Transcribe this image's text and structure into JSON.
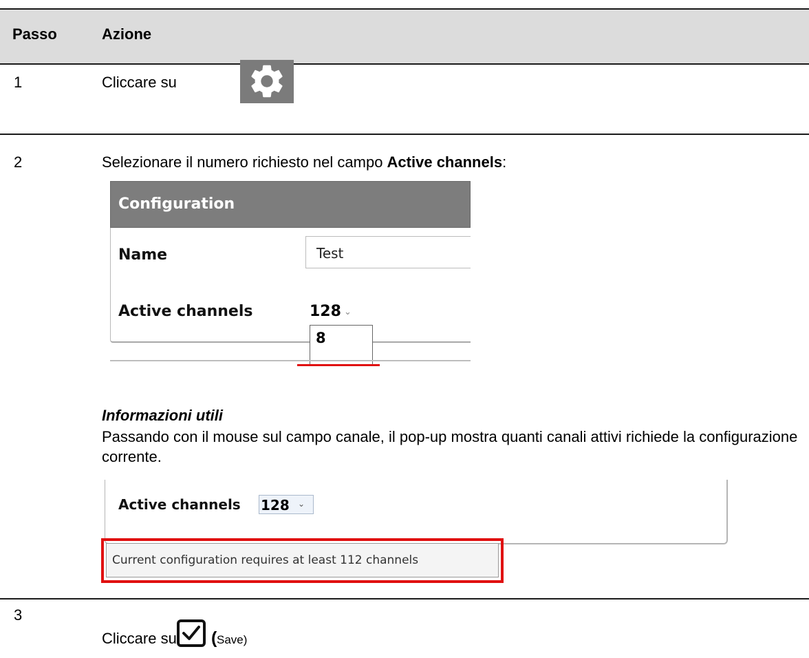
{
  "header": {
    "col1": "Passo",
    "col2": "Azione"
  },
  "steps": [
    {
      "num": "1",
      "text": "Cliccare su",
      "icon": "gear-icon"
    },
    {
      "num": "2",
      "text_pre": "Selezionare il numero richiesto nel campo ",
      "text_bold": "Active channels",
      "text_post": ":",
      "config": {
        "title": "Configuration",
        "name_label": "Name",
        "name_value": "Test",
        "channels_label": "Active channels",
        "channels_value": "128",
        "dropdown_option": "8"
      },
      "tip": {
        "title": "Informazioni utili",
        "body": "Passando con il mouse sul campo canale, il pop-up mostra quanti canali attivi richiede la configurazione corrente.",
        "channels_label": "Active channels",
        "channels_value": "128",
        "tooltip": "Current configuration requires at least 112 channels"
      }
    },
    {
      "num": "3",
      "text": "Cliccare su",
      "save_paren_open": "(",
      "save_label": "Save)",
      "icon": "checkbox-save-icon"
    }
  ],
  "colors": {
    "highlight": "#e01010",
    "header_bg": "#dcdcdc",
    "config_title_bg": "#7d7d7d"
  }
}
